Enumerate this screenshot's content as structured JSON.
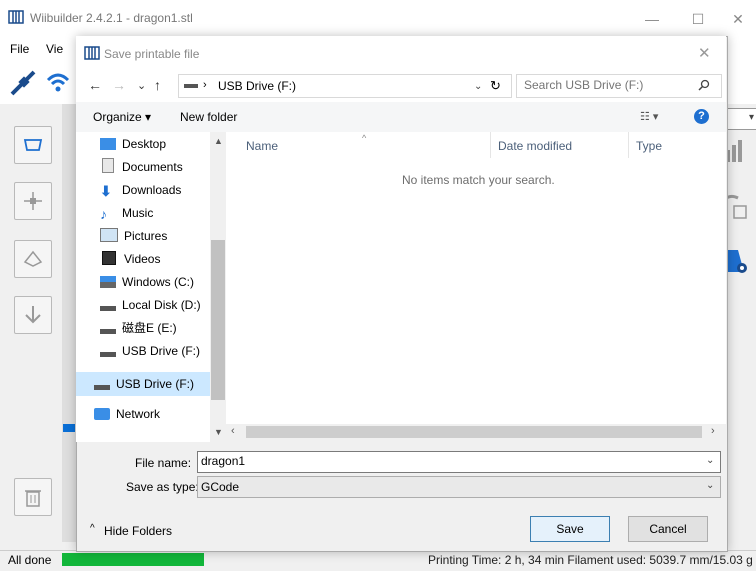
{
  "app": {
    "title": "Wiibuilder 2.4.2.1 - dragon1.stl",
    "menu": [
      "File",
      "Vie"
    ],
    "minimize_label": "—",
    "maximize_label": "☐",
    "close_label": "✕"
  },
  "status": {
    "text": "All done",
    "progress": 1.0,
    "info": "Printing Time:  2 h, 34 min  Filament used:  5039.7 mm/15.03 g",
    "progress_color": "#12b63a"
  },
  "dialog": {
    "title": "Save printable file",
    "close_label": "✕",
    "nav": {
      "back": "←",
      "forward": "→",
      "recent": "⌄",
      "up": "↑"
    },
    "address": "USB Drive (F:)",
    "refresh_label": "↻",
    "search_placeholder": "Search USB Drive (F:)",
    "organize": "Organize ▾",
    "new_folder": "New folder",
    "help": "?",
    "sidebar": [
      {
        "label": "Desktop",
        "icon": "desktop-icon"
      },
      {
        "label": "Documents",
        "icon": "documents-icon"
      },
      {
        "label": "Downloads",
        "icon": "downloads-icon"
      },
      {
        "label": "Music",
        "icon": "music-icon"
      },
      {
        "label": "Pictures",
        "icon": "pictures-icon"
      },
      {
        "label": "Videos",
        "icon": "videos-icon"
      },
      {
        "label": "Windows (C:)",
        "icon": "drive-c-icon"
      },
      {
        "label": "Local Disk (D:)",
        "icon": "drive-icon"
      },
      {
        "label": "磁盘E (E:)",
        "icon": "drive-icon"
      },
      {
        "label": "USB Drive (F:)",
        "icon": "usb-drive-icon"
      }
    ],
    "sidebar_selected": "USB Drive (F:)",
    "sidebar_network": "Network",
    "columns": [
      "Name",
      "Date modified",
      "Type"
    ],
    "empty_message": "No items match your search.",
    "file_name_label": "File name:",
    "file_name_value": "dragon1",
    "save_as_type_label": "Save as type:",
    "save_as_type_value": "GCode",
    "hide_folders": "Hide Folders",
    "save_button": "Save",
    "cancel_button": "Cancel"
  },
  "colors": {
    "accent": "#1e6fd0",
    "selection": "#cce8ff"
  }
}
